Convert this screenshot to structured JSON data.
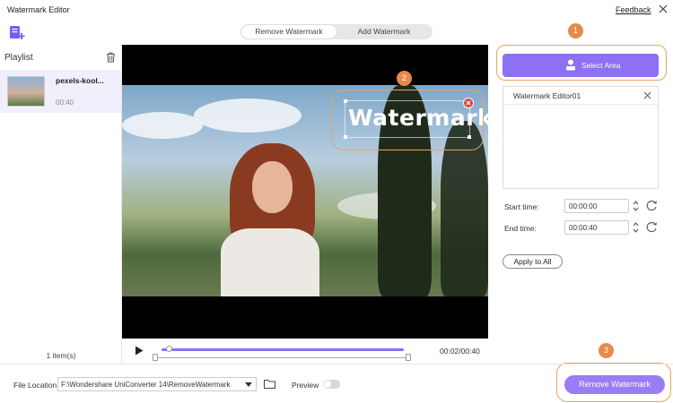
{
  "window": {
    "title": "Watermark Editor",
    "feedback_label": "Feedback"
  },
  "tabs": [
    {
      "label": "Remove Watermark",
      "active": true
    },
    {
      "label": "Add Watermark",
      "active": false
    }
  ],
  "sidebar": {
    "title": "Playlist",
    "items": [
      {
        "name": "pexels-kool...",
        "duration": "00:40",
        "selected": true
      }
    ],
    "count_label": "1 item(s)"
  },
  "video": {
    "watermark_text": "Watermark",
    "current_time": "00:02/00:40",
    "progress_fraction": 0.02
  },
  "steps": [
    "1",
    "2",
    "3"
  ],
  "right_panel": {
    "select_area_label": "Select Area",
    "watermark_list": [
      {
        "label": "Watermark Editor01"
      }
    ],
    "start_time": {
      "label": "Start time:",
      "value": "00:00:00"
    },
    "end_time": {
      "label": "End time:",
      "value": "00:00:40"
    },
    "apply_all_label": "Apply to All"
  },
  "bottom": {
    "file_location_label": "File Location:",
    "file_location_value": "F:\\Wondershare UniConverter 14\\RemoveWatermark",
    "preview_label": "Preview",
    "preview_enabled": false,
    "remove_button_label": "Remove Watermark"
  },
  "colors": {
    "accent": "#8d70f4",
    "step_badge": "#e8894a",
    "highlight_ring": "#e8a460"
  }
}
